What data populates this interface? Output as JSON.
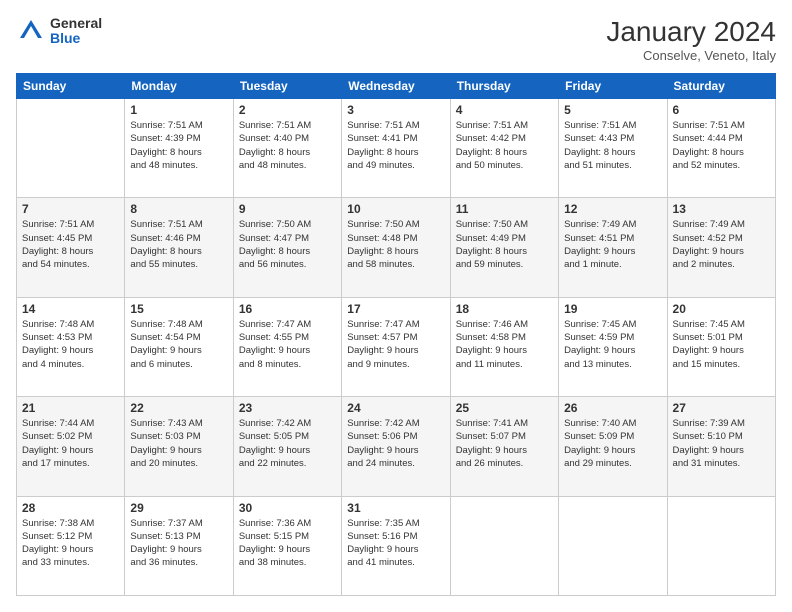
{
  "header": {
    "logo": {
      "general": "General",
      "blue": "Blue"
    },
    "title": "January 2024",
    "location": "Conselve, Veneto, Italy"
  },
  "weekdays": [
    "Sunday",
    "Monday",
    "Tuesday",
    "Wednesday",
    "Thursday",
    "Friday",
    "Saturday"
  ],
  "weeks": [
    [
      {
        "day": "",
        "sunrise": "",
        "sunset": "",
        "daylight": ""
      },
      {
        "day": "1",
        "sunrise": "Sunrise: 7:51 AM",
        "sunset": "Sunset: 4:39 PM",
        "daylight": "Daylight: 8 hours and 48 minutes."
      },
      {
        "day": "2",
        "sunrise": "Sunrise: 7:51 AM",
        "sunset": "Sunset: 4:40 PM",
        "daylight": "Daylight: 8 hours and 48 minutes."
      },
      {
        "day": "3",
        "sunrise": "Sunrise: 7:51 AM",
        "sunset": "Sunset: 4:41 PM",
        "daylight": "Daylight: 8 hours and 49 minutes."
      },
      {
        "day": "4",
        "sunrise": "Sunrise: 7:51 AM",
        "sunset": "Sunset: 4:42 PM",
        "daylight": "Daylight: 8 hours and 50 minutes."
      },
      {
        "day": "5",
        "sunrise": "Sunrise: 7:51 AM",
        "sunset": "Sunset: 4:43 PM",
        "daylight": "Daylight: 8 hours and 51 minutes."
      },
      {
        "day": "6",
        "sunrise": "Sunrise: 7:51 AM",
        "sunset": "Sunset: 4:44 PM",
        "daylight": "Daylight: 8 hours and 52 minutes."
      }
    ],
    [
      {
        "day": "7",
        "sunrise": "Sunrise: 7:51 AM",
        "sunset": "Sunset: 4:45 PM",
        "daylight": "Daylight: 8 hours and 54 minutes."
      },
      {
        "day": "8",
        "sunrise": "Sunrise: 7:51 AM",
        "sunset": "Sunset: 4:46 PM",
        "daylight": "Daylight: 8 hours and 55 minutes."
      },
      {
        "day": "9",
        "sunrise": "Sunrise: 7:50 AM",
        "sunset": "Sunset: 4:47 PM",
        "daylight": "Daylight: 8 hours and 56 minutes."
      },
      {
        "day": "10",
        "sunrise": "Sunrise: 7:50 AM",
        "sunset": "Sunset: 4:48 PM",
        "daylight": "Daylight: 8 hours and 58 minutes."
      },
      {
        "day": "11",
        "sunrise": "Sunrise: 7:50 AM",
        "sunset": "Sunset: 4:49 PM",
        "daylight": "Daylight: 8 hours and 59 minutes."
      },
      {
        "day": "12",
        "sunrise": "Sunrise: 7:49 AM",
        "sunset": "Sunset: 4:51 PM",
        "daylight": "Daylight: 9 hours and 1 minute."
      },
      {
        "day": "13",
        "sunrise": "Sunrise: 7:49 AM",
        "sunset": "Sunset: 4:52 PM",
        "daylight": "Daylight: 9 hours and 2 minutes."
      }
    ],
    [
      {
        "day": "14",
        "sunrise": "Sunrise: 7:48 AM",
        "sunset": "Sunset: 4:53 PM",
        "daylight": "Daylight: 9 hours and 4 minutes."
      },
      {
        "day": "15",
        "sunrise": "Sunrise: 7:48 AM",
        "sunset": "Sunset: 4:54 PM",
        "daylight": "Daylight: 9 hours and 6 minutes."
      },
      {
        "day": "16",
        "sunrise": "Sunrise: 7:47 AM",
        "sunset": "Sunset: 4:55 PM",
        "daylight": "Daylight: 9 hours and 8 minutes."
      },
      {
        "day": "17",
        "sunrise": "Sunrise: 7:47 AM",
        "sunset": "Sunset: 4:57 PM",
        "daylight": "Daylight: 9 hours and 9 minutes."
      },
      {
        "day": "18",
        "sunrise": "Sunrise: 7:46 AM",
        "sunset": "Sunset: 4:58 PM",
        "daylight": "Daylight: 9 hours and 11 minutes."
      },
      {
        "day": "19",
        "sunrise": "Sunrise: 7:45 AM",
        "sunset": "Sunset: 4:59 PM",
        "daylight": "Daylight: 9 hours and 13 minutes."
      },
      {
        "day": "20",
        "sunrise": "Sunrise: 7:45 AM",
        "sunset": "Sunset: 5:01 PM",
        "daylight": "Daylight: 9 hours and 15 minutes."
      }
    ],
    [
      {
        "day": "21",
        "sunrise": "Sunrise: 7:44 AM",
        "sunset": "Sunset: 5:02 PM",
        "daylight": "Daylight: 9 hours and 17 minutes."
      },
      {
        "day": "22",
        "sunrise": "Sunrise: 7:43 AM",
        "sunset": "Sunset: 5:03 PM",
        "daylight": "Daylight: 9 hours and 20 minutes."
      },
      {
        "day": "23",
        "sunrise": "Sunrise: 7:42 AM",
        "sunset": "Sunset: 5:05 PM",
        "daylight": "Daylight: 9 hours and 22 minutes."
      },
      {
        "day": "24",
        "sunrise": "Sunrise: 7:42 AM",
        "sunset": "Sunset: 5:06 PM",
        "daylight": "Daylight: 9 hours and 24 minutes."
      },
      {
        "day": "25",
        "sunrise": "Sunrise: 7:41 AM",
        "sunset": "Sunset: 5:07 PM",
        "daylight": "Daylight: 9 hours and 26 minutes."
      },
      {
        "day": "26",
        "sunrise": "Sunrise: 7:40 AM",
        "sunset": "Sunset: 5:09 PM",
        "daylight": "Daylight: 9 hours and 29 minutes."
      },
      {
        "day": "27",
        "sunrise": "Sunrise: 7:39 AM",
        "sunset": "Sunset: 5:10 PM",
        "daylight": "Daylight: 9 hours and 31 minutes."
      }
    ],
    [
      {
        "day": "28",
        "sunrise": "Sunrise: 7:38 AM",
        "sunset": "Sunset: 5:12 PM",
        "daylight": "Daylight: 9 hours and 33 minutes."
      },
      {
        "day": "29",
        "sunrise": "Sunrise: 7:37 AM",
        "sunset": "Sunset: 5:13 PM",
        "daylight": "Daylight: 9 hours and 36 minutes."
      },
      {
        "day": "30",
        "sunrise": "Sunrise: 7:36 AM",
        "sunset": "Sunset: 5:15 PM",
        "daylight": "Daylight: 9 hours and 38 minutes."
      },
      {
        "day": "31",
        "sunrise": "Sunrise: 7:35 AM",
        "sunset": "Sunset: 5:16 PM",
        "daylight": "Daylight: 9 hours and 41 minutes."
      },
      {
        "day": "",
        "sunrise": "",
        "sunset": "",
        "daylight": ""
      },
      {
        "day": "",
        "sunrise": "",
        "sunset": "",
        "daylight": ""
      },
      {
        "day": "",
        "sunrise": "",
        "sunset": "",
        "daylight": ""
      }
    ]
  ]
}
